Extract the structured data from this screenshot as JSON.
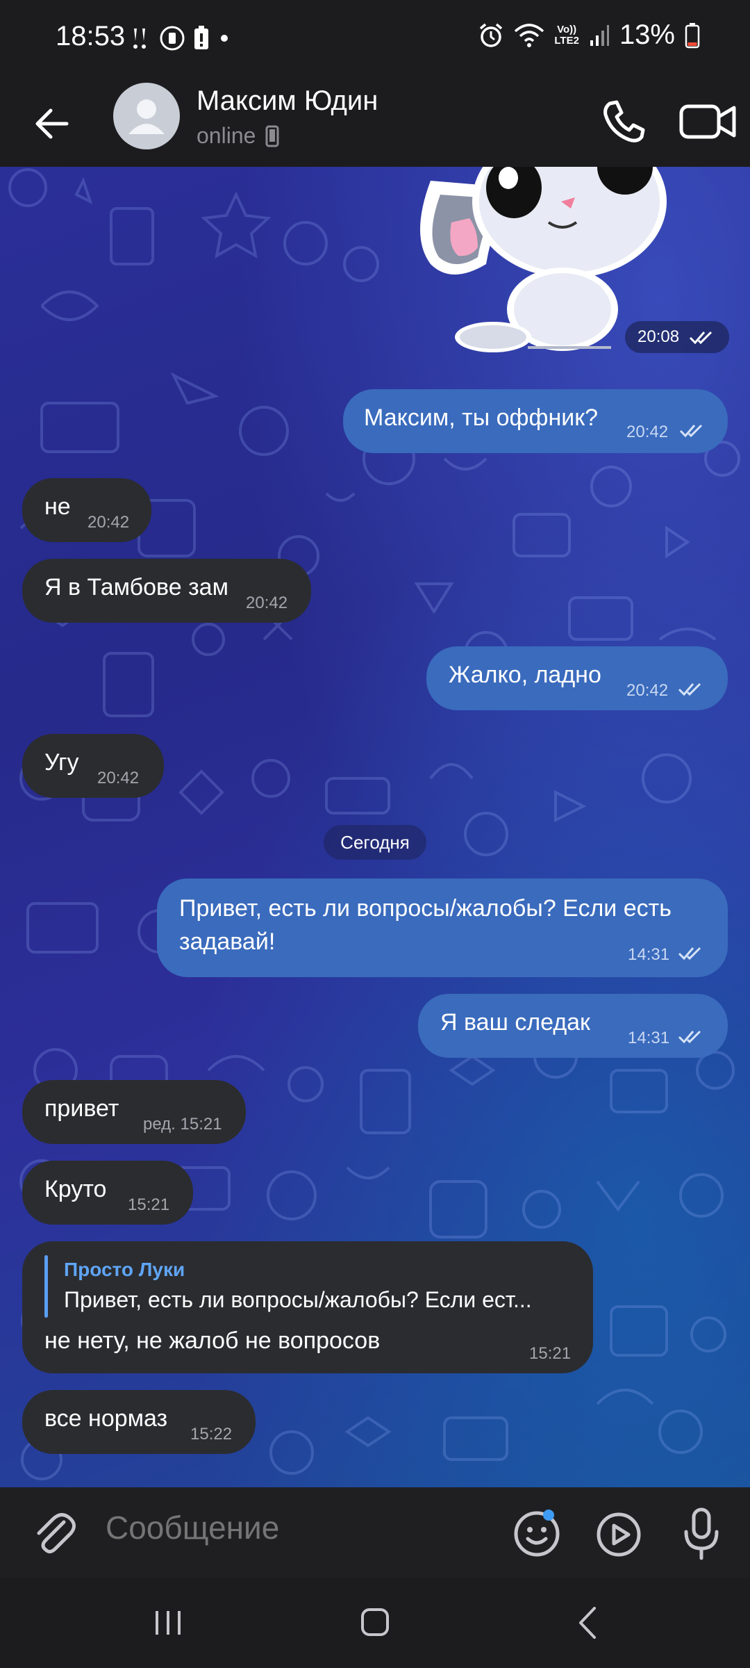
{
  "status_bar": {
    "time": "18:53",
    "network": [
      "Vo))",
      "LTE2"
    ],
    "battery_percent": "13%"
  },
  "header": {
    "contact_name": "Максим Юдин",
    "contact_status": "online"
  },
  "chat": {
    "sticker_time": "20:08",
    "date_separator": "Сегодня",
    "messages": [
      {
        "dir": "out",
        "text": "Максим, ты оффник?",
        "time": "20:42"
      },
      {
        "dir": "in",
        "text": "не",
        "time": "20:42"
      },
      {
        "dir": "in",
        "text": "Я в Тамбове зам",
        "time": "20:42"
      },
      {
        "dir": "out",
        "text": "Жалко, ладно",
        "time": "20:42"
      },
      {
        "dir": "in",
        "text": "Угу",
        "time": "20:42"
      },
      {
        "dir": "out",
        "text_line1": "Привет, есть ли вопросы/жалобы? Если есть",
        "text_line2": "задавай!",
        "time": "14:31"
      },
      {
        "dir": "out",
        "text": "Я ваш следак",
        "time": "14:31"
      },
      {
        "dir": "in",
        "text": "привет",
        "time": "ред. 15:21"
      },
      {
        "dir": "in",
        "text": "Круто",
        "time": "15:21"
      },
      {
        "dir": "in",
        "reply_author": "Просто Луки",
        "reply_text": "Привет, есть ли вопросы/жалобы? Если ест...",
        "text": "не нету, не жалоб не вопросов",
        "time": "15:21"
      },
      {
        "dir": "in",
        "text": "все нормаз",
        "time": "15:22"
      }
    ]
  },
  "input_bar": {
    "placeholder": "Сообщение"
  },
  "icons": {
    "back": "arrow-left-icon",
    "call": "phone-icon",
    "video": "video-camera-icon",
    "attach": "paperclip-icon",
    "emoji": "smiley-icon",
    "video_message": "play-circle-icon",
    "voice": "microphone-icon"
  },
  "colors": {
    "incoming_bubble": "#2b2c30",
    "outgoing_bubble": "#3a6bbd",
    "reply_accent": "#5fa5f5",
    "bar_background": "#1c1c1e"
  }
}
